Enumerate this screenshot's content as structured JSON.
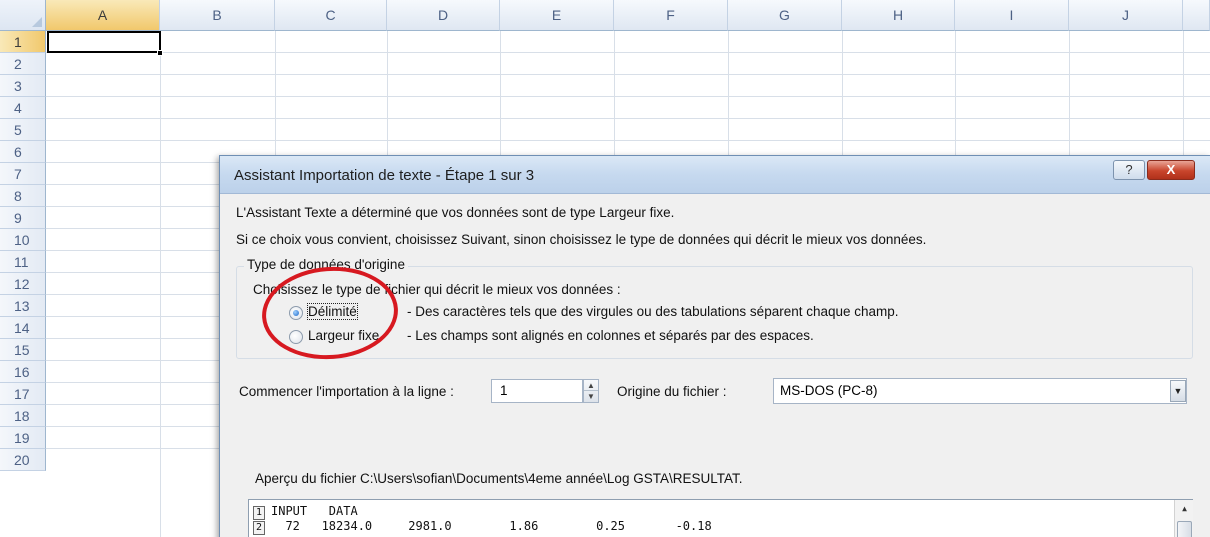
{
  "sheet": {
    "columns": [
      "A",
      "B",
      "C",
      "D",
      "E",
      "F",
      "G",
      "H",
      "I",
      "J"
    ],
    "rows": [
      "1",
      "2",
      "3",
      "4",
      "5",
      "6",
      "7",
      "8",
      "9",
      "10",
      "11",
      "12",
      "13",
      "14",
      "15",
      "16",
      "17",
      "18",
      "19",
      "20"
    ],
    "active_cell": "A1"
  },
  "dialog": {
    "title": "Assistant Importation de texte - Étape 1 sur 3",
    "help_button": "?",
    "close_button": "X",
    "intro_line1": "L'Assistant Texte a déterminé que vos données sont de type Largeur fixe.",
    "intro_line2": "Si ce choix vous convient, choisissez Suivant, sinon choisissez le type de données qui décrit le mieux vos données.",
    "group_title": "Type de données d'origine",
    "group_prompt": "Choisissez le type de fichier qui décrit le mieux vos données :",
    "options": [
      {
        "label": "Délimité",
        "description": "- Des caractères tels que des virgules ou des tabulations séparent chaque champ.",
        "checked": true
      },
      {
        "label": "Largeur fixe",
        "description": "- Les champs sont alignés en colonnes et séparés par des espaces.",
        "checked": false
      }
    ],
    "start_row_label": "Commencer l'importation à la ligne :",
    "start_row_value": "1",
    "origin_label": "Origine du fichier :",
    "origin_value": "MS-DOS (PC-8)",
    "preview_label": "Aperçu du fichier C:\\Users\\sofian\\Documents\\4eme année\\Log GSTA\\RESULTAT.",
    "preview_lines": [
      {
        "num": "1",
        "text": "INPUT   DATA"
      },
      {
        "num": "2",
        "text": "  72   18234.0     2981.0        1.86        0.25       -0.18"
      }
    ]
  },
  "colors": {
    "annotation_circle": "#d71920",
    "header_highlight": "#f1c86c"
  }
}
